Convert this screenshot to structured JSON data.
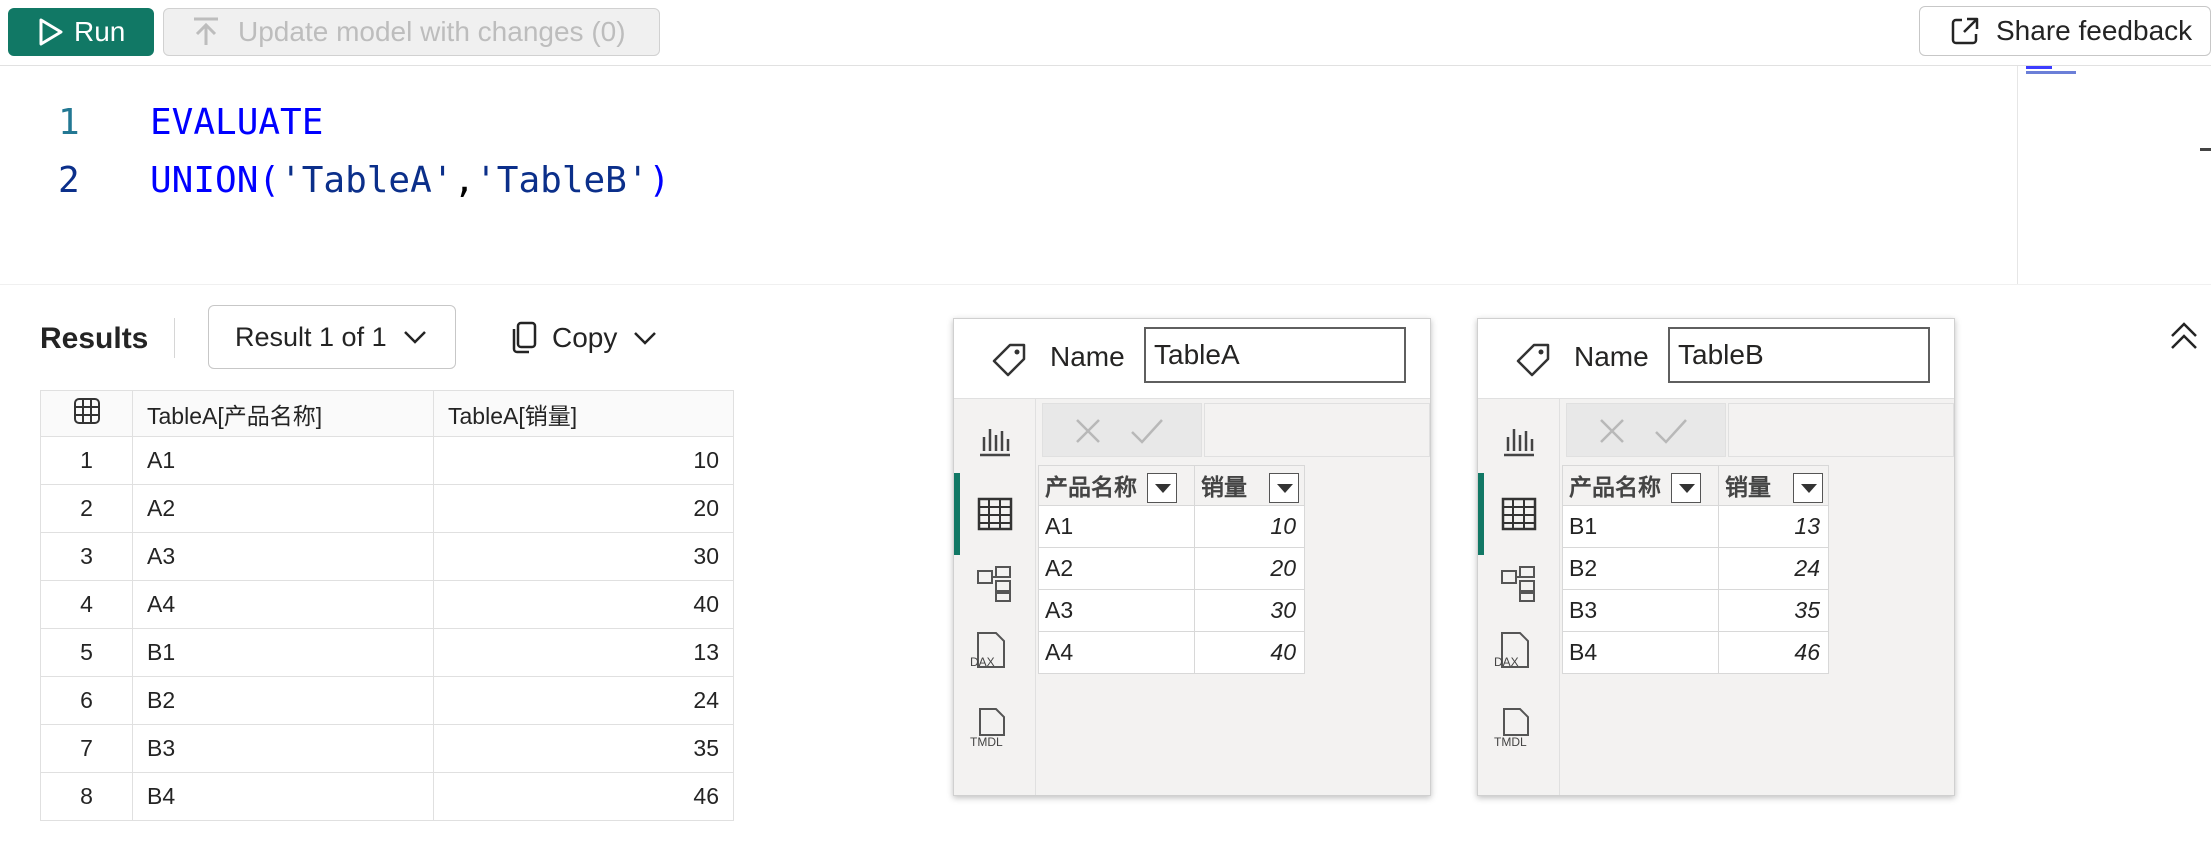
{
  "toolbar": {
    "run_label": "Run",
    "update_label": "Update model with changes (0)",
    "feedback_label": "Share feedback"
  },
  "editor": {
    "lines": [
      {
        "num": "1",
        "code": "EVALUATE"
      },
      {
        "num": "2",
        "code_fn": "UNION(",
        "code_s1": "'TableA'",
        "code_comma": ",",
        "code_s2": "'TableB'",
        "code_close": ")"
      }
    ]
  },
  "results": {
    "title": "Results",
    "result_selector": "Result 1 of 1",
    "copy_label": "Copy",
    "columns": [
      "TableA[产品名称]",
      "TableA[销量]"
    ],
    "rows": [
      {
        "idx": "1",
        "name": "A1",
        "value": "10"
      },
      {
        "idx": "2",
        "name": "A2",
        "value": "20"
      },
      {
        "idx": "3",
        "name": "A3",
        "value": "30"
      },
      {
        "idx": "4",
        "name": "A4",
        "value": "40"
      },
      {
        "idx": "5",
        "name": "B1",
        "value": "13"
      },
      {
        "idx": "6",
        "name": "B2",
        "value": "24"
      },
      {
        "idx": "7",
        "name": "B3",
        "value": "35"
      },
      {
        "idx": "8",
        "name": "B4",
        "value": "46"
      }
    ]
  },
  "panels": [
    {
      "name_label": "Name",
      "name_value": "TableA",
      "columns": [
        "产品名称",
        "销量"
      ],
      "rows": [
        [
          "A1",
          "10"
        ],
        [
          "A2",
          "20"
        ],
        [
          "A3",
          "30"
        ],
        [
          "A4",
          "40"
        ]
      ]
    },
    {
      "name_label": "Name",
      "name_value": "TableB",
      "columns": [
        "产品名称",
        "销量"
      ],
      "rows": [
        [
          "B1",
          "13"
        ],
        [
          "B2",
          "24"
        ],
        [
          "B3",
          "35"
        ],
        [
          "B4",
          "46"
        ]
      ]
    }
  ],
  "icons": {
    "side": [
      "report-view-icon",
      "table-view-icon",
      "model-view-icon",
      "dax-query-icon",
      "tmdl-view-icon"
    ],
    "side_labels": {
      "dax": "DAX",
      "tmdl": "TMDL"
    }
  },
  "colors": {
    "accent": "#117865",
    "keyword": "#0000ff",
    "string": "#0b2f8a",
    "line_number": "#237893"
  }
}
